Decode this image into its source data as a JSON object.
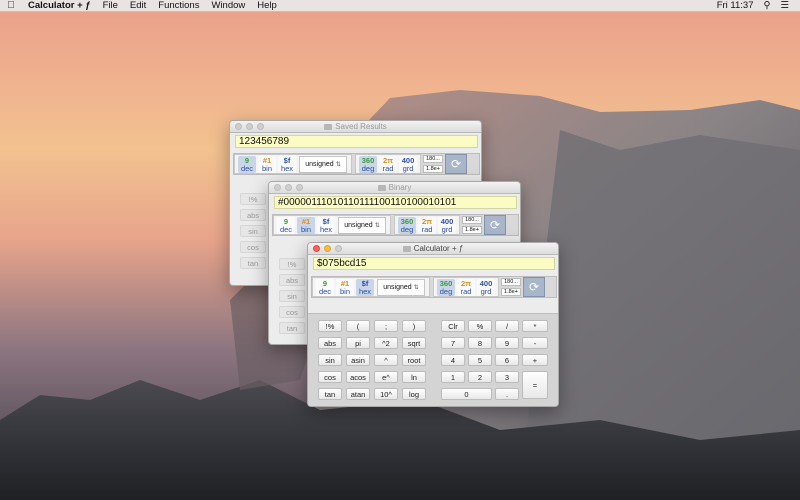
{
  "menubar": {
    "apple": "",
    "app_name": "Calculator + ƒ",
    "menus": [
      "File",
      "Edit",
      "Functions",
      "Window",
      "Help"
    ],
    "clock": "Fri 11:37",
    "search_icon": "magnifier-icon",
    "list_icon": "list-icon"
  },
  "mode_buttons": {
    "dec": {
      "top": "9",
      "bottom": "dec"
    },
    "bin": {
      "top": "#1",
      "bottom": "bin"
    },
    "hex": {
      "top": "$f",
      "bottom": "hex"
    },
    "deg": {
      "top": "360",
      "bottom": "deg"
    },
    "rad": {
      "top": "2π",
      "bottom": "rad"
    },
    "grd": {
      "top": "400",
      "bottom": "grd"
    },
    "signedness": "unsigned",
    "format_top": "180...",
    "format_bottom": "1.8e+"
  },
  "windows": {
    "saved": {
      "title": "Saved Results",
      "display": "123456789"
    },
    "binary": {
      "title": "Binary",
      "display": "#00000111010110111100110100010101"
    },
    "calc": {
      "title": "Calculator + ƒ",
      "display": "$075bcd15"
    }
  },
  "side_keys": [
    "!%",
    "abs",
    "sin",
    "cos",
    "tan"
  ],
  "keypad": {
    "functions": [
      [
        "!%",
        "(",
        ";",
        ")"
      ],
      [
        "abs",
        "pi",
        "^2",
        "sqrt"
      ],
      [
        "sin",
        "asin",
        "^",
        "root"
      ],
      [
        "cos",
        "acos",
        "e^",
        "ln"
      ],
      [
        "tan",
        "atan",
        "10^",
        "log"
      ]
    ],
    "numeric": [
      [
        "Clr",
        "%",
        "/",
        "*"
      ],
      [
        "7",
        "8",
        "9",
        "-"
      ],
      [
        "4",
        "5",
        "6",
        "+"
      ],
      [
        "1",
        "2",
        "3"
      ],
      [
        "0",
        "."
      ]
    ],
    "equals": "="
  },
  "colors": {
    "display_bg": "#fbfbc4",
    "close": "#fc605c",
    "minimize": "#fdbc40"
  }
}
